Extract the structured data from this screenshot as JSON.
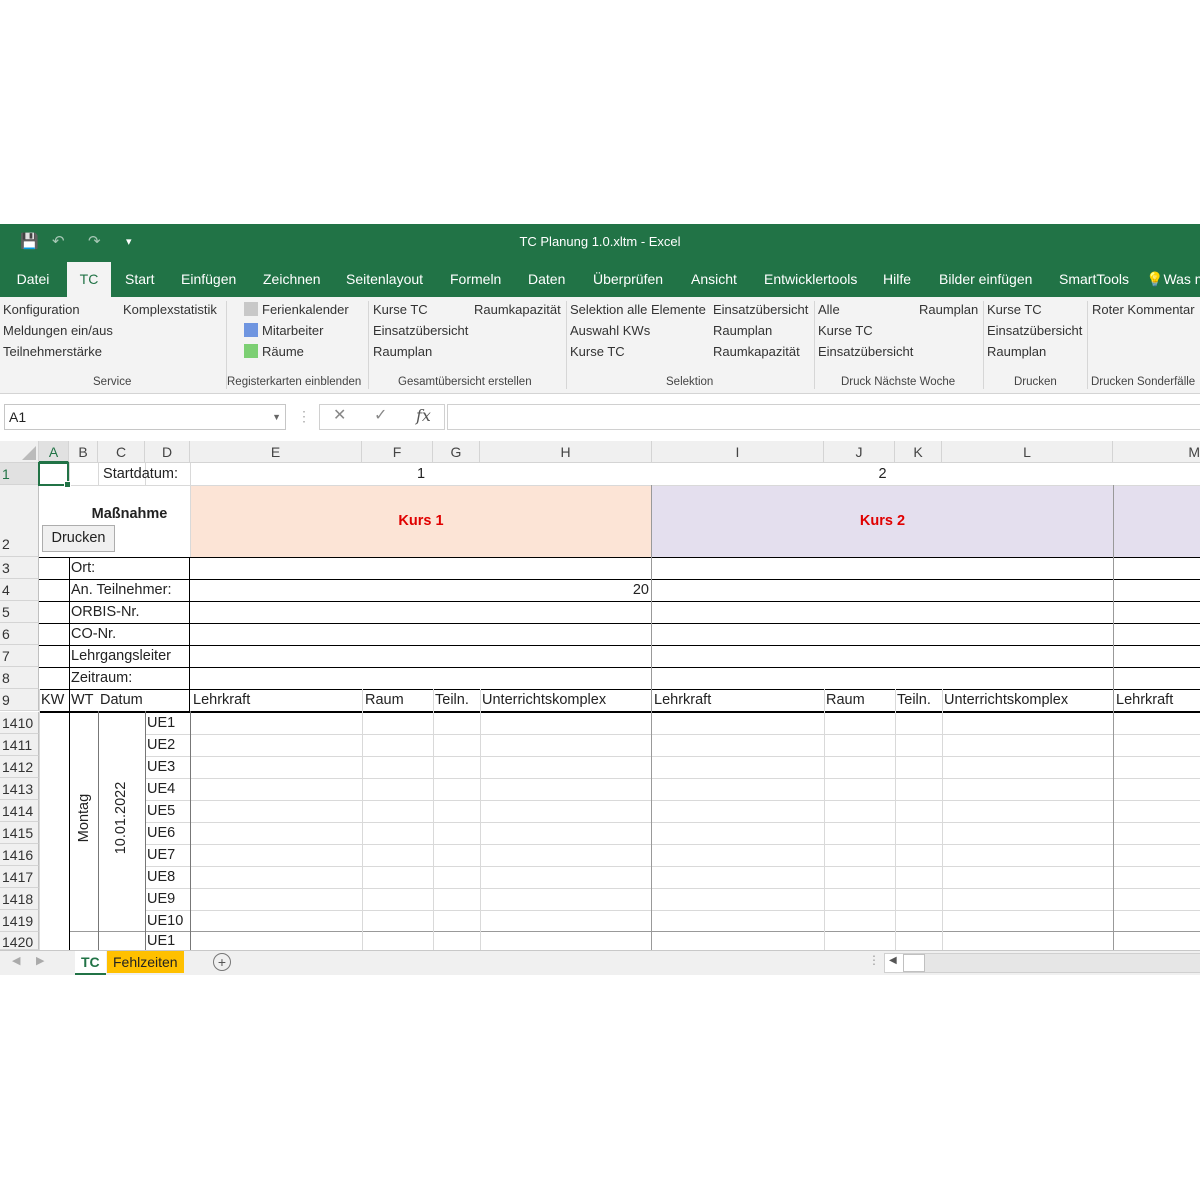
{
  "title": "TC Planung 1.0.xltm  -  Excel",
  "qat": {
    "save": "💾",
    "undo": "↶",
    "redo": "↷",
    "more": "▾"
  },
  "tabs": [
    "Datei",
    "TC",
    "Start",
    "Einfügen",
    "Zeichnen",
    "Seitenlayout",
    "Formeln",
    "Daten",
    "Überprüfen",
    "Ansicht",
    "Entwicklertools",
    "Hilfe",
    "Bilder einfügen",
    "SmartTools",
    "Was m"
  ],
  "active_tab": "TC",
  "ribbon": {
    "service": {
      "label": "Service",
      "items": [
        "Konfiguration",
        "Komplexstatistik",
        "Meldungen ein/aus",
        "Teilnehmerstärke"
      ]
    },
    "register": {
      "label": "Registerkarten einblenden",
      "items": [
        "Ferienkalender",
        "Mitarbeiter",
        "Räume"
      ],
      "colors": [
        "#c8c8c8",
        "#6f95e0",
        "#7ccf73"
      ]
    },
    "gesamt": {
      "label": "Gesamtübersicht erstellen",
      "items": [
        "Kurse TC",
        "Raumkapazität",
        "Einsatzübersicht",
        "Raumplan"
      ]
    },
    "selektion": {
      "label": "Selektion",
      "items": [
        "Selektion alle Elemente",
        "Einsatzübersicht",
        "Auswahl KWs",
        "Raumplan",
        "Kurse TC",
        "Raumkapazität"
      ]
    },
    "druck_naechste": {
      "label": "Druck Nächste Woche",
      "items": [
        "Alle",
        "Raumplan",
        "Kurse TC",
        "Einsatzübersicht"
      ]
    },
    "drucken": {
      "label": "Drucken",
      "items": [
        "Kurse TC",
        "Einsatzübersicht",
        "Raumplan"
      ]
    },
    "sonder": {
      "label": "Drucken Sonderfälle",
      "items": [
        "Roter Kommentar"
      ]
    }
  },
  "formula_bar": {
    "name_box": "A1",
    "cancel": "✕",
    "enter": "✓",
    "fx": "fx",
    "formula": ""
  },
  "columns": [
    "A",
    "B",
    "C",
    "D",
    "E",
    "F",
    "G",
    "H",
    "I",
    "J",
    "K",
    "L",
    "M"
  ],
  "rows": {
    "numbers": [
      "1",
      "2",
      "3",
      "4",
      "5",
      "6",
      "7",
      "8",
      "9",
      "1410",
      "1411",
      "1412",
      "1413",
      "1414",
      "1415",
      "1416",
      "1417",
      "1418",
      "1419",
      "1420"
    ],
    "startdatum": "Startdatum:",
    "kurs1_num": "1",
    "kurs2_num": "2",
    "massnahme": "Maßnahme",
    "drucken_btn": "Drucken",
    "kurs1": "Kurs 1",
    "kurs2": "Kurs 2",
    "labels": [
      "Ort:",
      "An. Teilnehmer:",
      "ORBIS-Nr.",
      "CO-Nr.",
      "Lehrgangsleiter",
      "Zeitraum:"
    ],
    "teilnehmer_value": "20",
    "header9": {
      "kw": "KW",
      "wt": "WT",
      "datum": "Datum",
      "lehrkraft": "Lehrkraft",
      "raum": "Raum",
      "teiln": "Teiln.",
      "komplex": "Unterrichtskomplex"
    },
    "weekday": "Montag",
    "date": "10.01.2022",
    "ue": [
      "UE1",
      "UE2",
      "UE3",
      "UE4",
      "UE5",
      "UE6",
      "UE7",
      "UE8",
      "UE9",
      "UE10",
      "UE1"
    ]
  },
  "sheet_tabs": [
    "TC",
    "Fehlzeiten"
  ],
  "colors": {
    "excel_green": "#217346",
    "kurs1_fill": "#fce4d6",
    "kurs2_fill": "#e4dfee",
    "kurs_text": "#e00000",
    "fehlzeiten_tab": "#ffc000"
  }
}
